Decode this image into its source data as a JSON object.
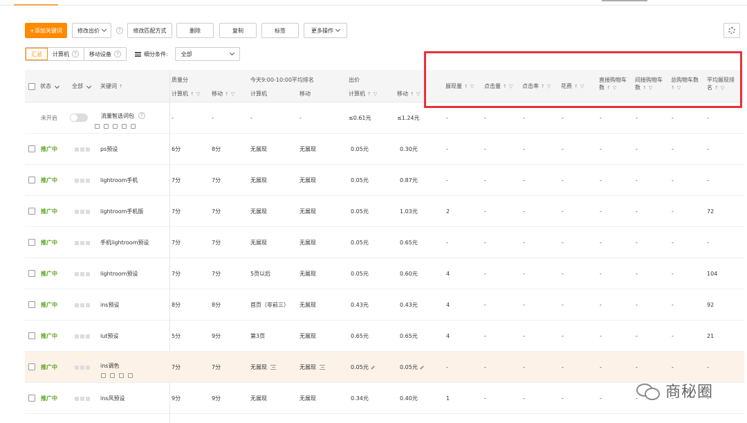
{
  "toolbar": {
    "add_keyword": "+添加关键词",
    "modify_bid": "修改出价",
    "modify_match": "修改匹配方式",
    "delete": "删除",
    "copy": "复制",
    "tag": "标签",
    "more_actions": "更多操作"
  },
  "filter": {
    "segments": [
      "汇总",
      "计算机",
      "移动设备"
    ],
    "condition_label": "细分条件:",
    "condition_value": "全部"
  },
  "header": {
    "status": "状态",
    "all": "全部",
    "keyword": "关键词",
    "quality_group": "质量分",
    "quality_pc": "计算机",
    "quality_mobile": "移动",
    "rank_group": "今天9:00-10:00平均排名",
    "rank_pc": "计算机",
    "rank_mobile": "移动",
    "bid_group": "出价",
    "bid_pc": "计算机",
    "bid_mobile": "移动",
    "impressions": "展现量",
    "clicks": "点击量",
    "ctr": "点击率",
    "cost": "花费",
    "direct_cart_1": "直接购物车",
    "direct_cart_2": "数",
    "indirect_cart_1": "间接购物车",
    "indirect_cart_2": "数",
    "total_cart_1": "总购物车数",
    "avg_rank_1": "平均展现排",
    "avg_rank_2": "名",
    "sort_mark": "↑",
    "filter_mark": "▽"
  },
  "rows": [
    {
      "status": "未开启",
      "keyword": "流量智选词包",
      "quality_pc": "-",
      "quality_mobile": "-",
      "rank_pc": "-",
      "rank_mobile": "-",
      "bid_pc": "≤0.61元",
      "bid_mobile": "≤1.24元",
      "impressions": "-",
      "clicks": "-",
      "ctr": "-",
      "cost": "-",
      "direct_cart": "-",
      "indirect_cart": "-",
      "total_cart": "-",
      "avg_rank": "-"
    },
    {
      "status": "推广中",
      "keyword": "ps预设",
      "quality_pc": "6分",
      "quality_mobile": "8分",
      "rank_pc": "无展现",
      "rank_mobile": "无展现",
      "bid_pc": "0.05元",
      "bid_mobile": "0.30元",
      "impressions": "-",
      "clicks": "-",
      "ctr": "-",
      "cost": "-",
      "direct_cart": "-",
      "indirect_cart": "-",
      "total_cart": "-",
      "avg_rank": "-"
    },
    {
      "status": "推广中",
      "keyword": "lightroom手机",
      "quality_pc": "7分",
      "quality_mobile": "7分",
      "rank_pc": "无展现",
      "rank_mobile": "无展现",
      "bid_pc": "0.05元",
      "bid_mobile": "0.87元",
      "impressions": "-",
      "clicks": "-",
      "ctr": "-",
      "cost": "-",
      "direct_cart": "-",
      "indirect_cart": "-",
      "total_cart": "-",
      "avg_rank": "-"
    },
    {
      "status": "推广中",
      "keyword": "lightroom手机版",
      "quality_pc": "7分",
      "quality_mobile": "7分",
      "rank_pc": "无展现",
      "rank_mobile": "无展现",
      "bid_pc": "0.05元",
      "bid_mobile": "1.03元",
      "impressions": "2",
      "clicks": "-",
      "ctr": "-",
      "cost": "-",
      "direct_cart": "-",
      "indirect_cart": "-",
      "total_cart": "-",
      "avg_rank": "72"
    },
    {
      "status": "推广中",
      "keyword": "手机lightroom预设",
      "quality_pc": "7分",
      "quality_mobile": "7分",
      "rank_pc": "无展现",
      "rank_mobile": "无展现",
      "bid_pc": "0.05元",
      "bid_mobile": "0.65元",
      "impressions": "-",
      "clicks": "-",
      "ctr": "-",
      "cost": "-",
      "direct_cart": "-",
      "indirect_cart": "-",
      "total_cart": "-",
      "avg_rank": "-"
    },
    {
      "status": "推广中",
      "keyword": "lightroom预设",
      "quality_pc": "7分",
      "quality_mobile": "7分",
      "rank_pc": "5页以后",
      "rank_mobile": "无展现",
      "bid_pc": "0.05元",
      "bid_mobile": "0.60元",
      "impressions": "4",
      "clicks": "-",
      "ctr": "-",
      "cost": "-",
      "direct_cart": "-",
      "indirect_cart": "-",
      "total_cart": "-",
      "avg_rank": "104"
    },
    {
      "status": "推广中",
      "keyword": "ins预设",
      "quality_pc": "8分",
      "quality_mobile": "8分",
      "rank_pc": "首页（非前三）",
      "rank_mobile": "无展现",
      "bid_pc": "0.43元",
      "bid_mobile": "0.43元",
      "impressions": "4",
      "clicks": "-",
      "ctr": "-",
      "cost": "-",
      "direct_cart": "-",
      "indirect_cart": "-",
      "total_cart": "-",
      "avg_rank": "92"
    },
    {
      "status": "推广中",
      "keyword": "lut预设",
      "quality_pc": "5分",
      "quality_mobile": "9分",
      "rank_pc": "第3页",
      "rank_mobile": "无展现",
      "bid_pc": "0.65元",
      "bid_mobile": "0.65元",
      "impressions": "4",
      "clicks": "-",
      "ctr": "-",
      "cost": "-",
      "direct_cart": "-",
      "indirect_cart": "-",
      "total_cart": "-",
      "avg_rank": "21"
    },
    {
      "status": "推广中",
      "keyword": "ins调色",
      "quality_pc": "7分",
      "quality_mobile": "7分",
      "rank_pc": "无展现",
      "rank_mobile": "无展现",
      "bid_pc": "0.05元",
      "bid_mobile": "0.05元",
      "impressions": "-",
      "clicks": "-",
      "ctr": "-",
      "cost": "-",
      "direct_cart": "-",
      "indirect_cart": "-",
      "total_cart": "-",
      "avg_rank": "-"
    },
    {
      "status": "推广中",
      "keyword": "ins风预设",
      "quality_pc": "9分",
      "quality_mobile": "9分",
      "rank_pc": "无展现",
      "rank_mobile": "无展现",
      "bid_pc": "0.34元",
      "bid_mobile": "0.40元",
      "impressions": "1",
      "clicks": "-",
      "ctr": "-",
      "cost": "-",
      "direct_cart": "-",
      "indirect_cart": "-",
      "total_cart": "-",
      "avg_rank": "-"
    }
  ],
  "help_mark": "?",
  "watermark": "商秘圈"
}
